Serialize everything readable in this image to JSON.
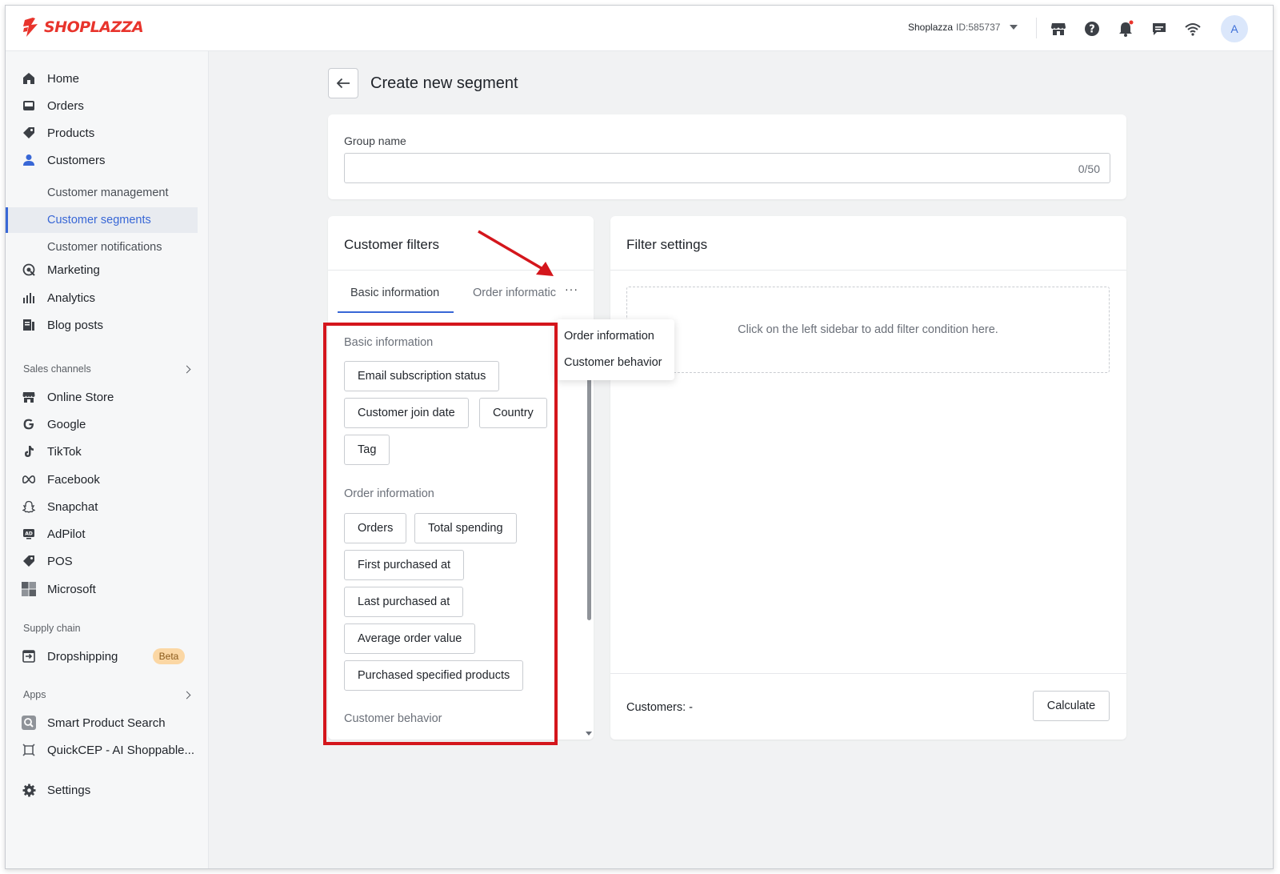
{
  "app": {
    "logo_text": "SHOPLAZZA",
    "brand_color": "#e8342c",
    "accent_color": "#3867d6"
  },
  "topbar": {
    "store_name": "Shoplazza",
    "store_id": "ID:585737",
    "icons": [
      "store-icon",
      "help-icon",
      "bell-icon",
      "chat-icon",
      "wifi-icon"
    ],
    "avatar_letter": "A"
  },
  "sidebar": {
    "items": [
      {
        "label": "Home",
        "icon": "home-icon"
      },
      {
        "label": "Orders",
        "icon": "inbox-icon"
      },
      {
        "label": "Products",
        "icon": "tag-icon"
      },
      {
        "label": "Customers",
        "icon": "person-icon"
      }
    ],
    "customer_subitems": [
      {
        "label": "Customer management"
      },
      {
        "label": "Customer segments",
        "active": true
      },
      {
        "label": "Customer notifications"
      }
    ],
    "items2": [
      {
        "label": "Marketing",
        "icon": "marketing-icon"
      },
      {
        "label": "Analytics",
        "icon": "analytics-icon"
      },
      {
        "label": "Blog posts",
        "icon": "blog-icon"
      }
    ],
    "sales_channels_label": "Sales channels",
    "sales_channels": [
      {
        "label": "Online Store",
        "icon": "store-icon"
      },
      {
        "label": "Google",
        "icon": "google-icon"
      },
      {
        "label": "TikTok",
        "icon": "tiktok-icon"
      },
      {
        "label": "Facebook",
        "icon": "meta-icon"
      },
      {
        "label": "Snapchat",
        "icon": "snapchat-icon"
      },
      {
        "label": "AdPilot",
        "icon": "adpilot-icon"
      },
      {
        "label": "POS",
        "icon": "pos-icon"
      },
      {
        "label": "Microsoft",
        "icon": "microsoft-icon"
      }
    ],
    "supply_chain_label": "Supply chain",
    "supply_chain": [
      {
        "label": "Dropshipping",
        "icon": "dropshipping-icon",
        "badge": "Beta"
      }
    ],
    "apps_label": "Apps",
    "apps": [
      {
        "label": "Smart Product Search",
        "icon": "smart-search-icon"
      },
      {
        "label": "QuickCEP - AI Shoppable...",
        "icon": "quickcep-icon"
      }
    ],
    "settings": {
      "label": "Settings",
      "icon": "gear-icon"
    }
  },
  "page": {
    "title": "Create new segment",
    "group_name_label": "Group name",
    "group_name_value": "",
    "group_name_count": "0/50"
  },
  "filters": {
    "title": "Customer filters",
    "tabs": [
      "Basic information",
      "Order informatic"
    ],
    "more_label": "···",
    "sections": [
      {
        "label": "Basic information",
        "chips": [
          "Email subscription status",
          "Customer join date",
          "Country",
          "Tag"
        ]
      },
      {
        "label": "Order information",
        "chips": [
          "Orders",
          "Total spending",
          "First purchased at",
          "Last purchased at",
          "Average order value",
          "Purchased specified products"
        ]
      },
      {
        "label": "Customer behavior",
        "chips": []
      }
    ],
    "popover_items": [
      "Order information",
      "Customer behavior"
    ]
  },
  "filter_settings": {
    "title": "Filter settings",
    "placeholder": "Click on the left sidebar to add filter condition here.",
    "customers_label": "Customers: -",
    "calculate_label": "Calculate"
  }
}
